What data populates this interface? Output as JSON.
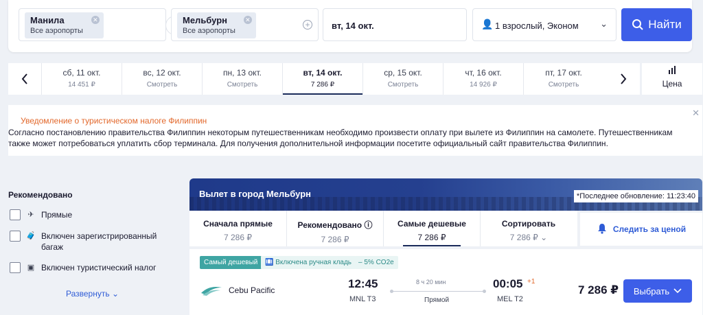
{
  "search": {
    "origin_city": "Манила",
    "origin_sub": "Все аэропорты",
    "destination_city": "Мельбурн",
    "destination_sub": "Все аэропорты",
    "date": "вт, 14 окт.",
    "passengers": "1 взрослый, Эконом",
    "find_label": "Найти"
  },
  "date_strip": {
    "days": [
      {
        "date": "сб, 11 окт.",
        "price": "14 451 ₽"
      },
      {
        "date": "вс, 12 окт.",
        "price": "Смотреть"
      },
      {
        "date": "пн, 13 окт.",
        "price": "Смотреть"
      },
      {
        "date": "вт, 14 окт.",
        "price": "7 286 ₽"
      },
      {
        "date": "ср, 15 окт.",
        "price": "Смотреть"
      },
      {
        "date": "чт, 16 окт.",
        "price": "14 926 ₽"
      },
      {
        "date": "пт, 17 окт.",
        "price": "Смотреть"
      }
    ],
    "price_toggle_label": "Цена"
  },
  "notice": {
    "title": "Уведомление о туристическом налоге Филиппин",
    "body": "Согласно постановлению правительства Филиппин некоторым путешественникам необходимо произвести оплату при вылете из Филиппин на самолете. Путешественникам также может потребоваться уплатить сбор терминала. Для получения дополнительной информации посетите официальный сайт правительства Филиппин."
  },
  "filters": {
    "title": "Рекомендовано",
    "items": [
      {
        "label": "Прямые"
      },
      {
        "label": "Включен зарегистрированный багаж"
      },
      {
        "label": "Включен туристический налог"
      }
    ],
    "expand_label": "Развернуть"
  },
  "results": {
    "heading": "Вылет в город Мельбурн",
    "last_update": "*Последнее обновление: 11:23:40",
    "sort_tabs": [
      {
        "title": "Сначала прямые",
        "value": "7 286 ₽"
      },
      {
        "title": "Рекомендовано",
        "value": "7 286 ₽"
      },
      {
        "title": "Самые дешевые",
        "value": "7 286 ₽"
      },
      {
        "title": "Сортировать",
        "value": "7 286 ₽"
      }
    ],
    "track_label": "Следить за ценой",
    "flight": {
      "tags": [
        "Самый дешевый",
        "Включена ручная кладь",
        "– 5% CO2e"
      ],
      "airline": "Cebu Pacific",
      "depart_time": "12:45",
      "depart_code": "MNL T3",
      "duration": "8 ч 20 мин",
      "stops": "Прямой",
      "arrive_time": "00:05",
      "day_offset": "+1",
      "arrive_code": "MEL T2",
      "price": "7 286 ₽",
      "select_label": "Выбрать"
    }
  },
  "colors": {
    "accent": "#3d5ee8",
    "warning": "#e2672a",
    "tag_teal": "#3fa5a3"
  }
}
